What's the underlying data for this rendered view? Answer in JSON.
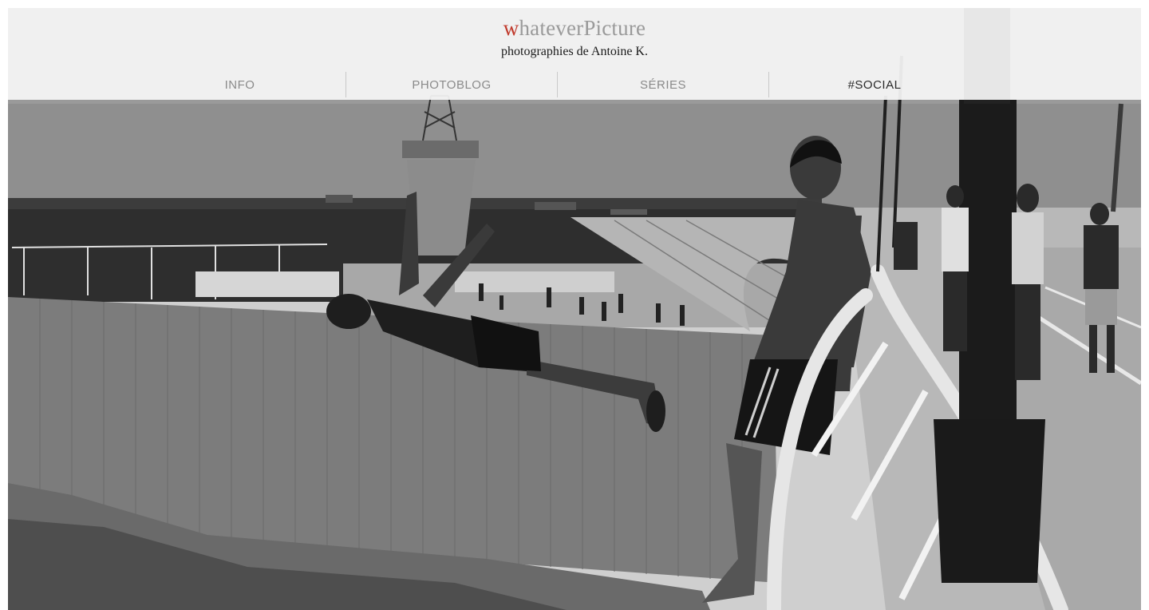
{
  "site": {
    "brand_first_letter": "w",
    "brand_rest": "hateverPicture",
    "tagline": "photographies de Antoine K.",
    "accent_color": "#c0392b"
  },
  "nav": {
    "items": [
      {
        "label": "INFO"
      },
      {
        "label": "PHOTOBLOG"
      },
      {
        "label": "SÉRIES"
      },
      {
        "label": "#SOCIAL"
      }
    ]
  },
  "photo": {
    "style": "black-and-white"
  }
}
